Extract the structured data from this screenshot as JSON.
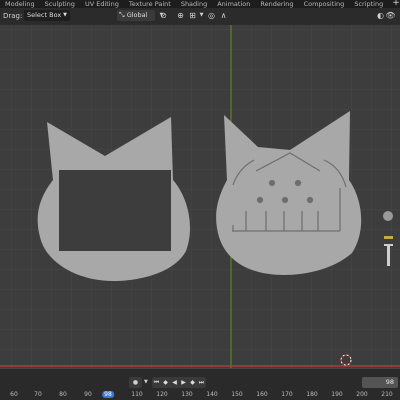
{
  "workspace_tabs": [
    "Modeling",
    "Sculpting",
    "UV Editing",
    "Texture Paint",
    "Shading",
    "Animation",
    "Rendering",
    "Compositing",
    "Scripting",
    "+"
  ],
  "header": {
    "drag_label": "Drag:",
    "select_mode": "Select Box",
    "transform_orientation": "Global"
  },
  "timeline": {
    "current_frame": "98",
    "ruler_ticks": [
      "60",
      "70",
      "80",
      "90",
      "98",
      "110",
      "120",
      "130",
      "140",
      "150",
      "160",
      "170",
      "180",
      "190",
      "200",
      "210"
    ]
  },
  "colors": {
    "viewport_bg": "#3d3d3d",
    "grid": "#474747",
    "object_fill": "#a8a8a8",
    "object_detail": "#6e6e6e",
    "axis_green": "#6b8e23",
    "axis_red": "#b23a3a",
    "playhead": "#3f78c8"
  }
}
